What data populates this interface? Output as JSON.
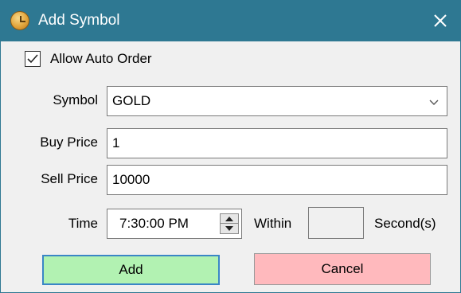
{
  "window": {
    "title": "Add Symbol",
    "title_bar_color": "#2e7892",
    "icons": {
      "app": "clock-icon",
      "close": "close-icon"
    }
  },
  "auto_order": {
    "label": "Allow Auto Order",
    "checked": true
  },
  "symbol": {
    "label": "Symbol",
    "value": "GOLD"
  },
  "buy_price": {
    "label": "Buy Price",
    "value": "1"
  },
  "sell_price": {
    "label": "Sell Price",
    "value": "10000"
  },
  "time": {
    "label": "Time",
    "value": "7:30:00 PM"
  },
  "within": {
    "label": "Within",
    "value": "",
    "unit": "Second(s)"
  },
  "buttons": {
    "add": {
      "label": "Add",
      "color": "#b2f2b2"
    },
    "cancel": {
      "label": "Cancel",
      "color": "#ffb9bd"
    }
  }
}
